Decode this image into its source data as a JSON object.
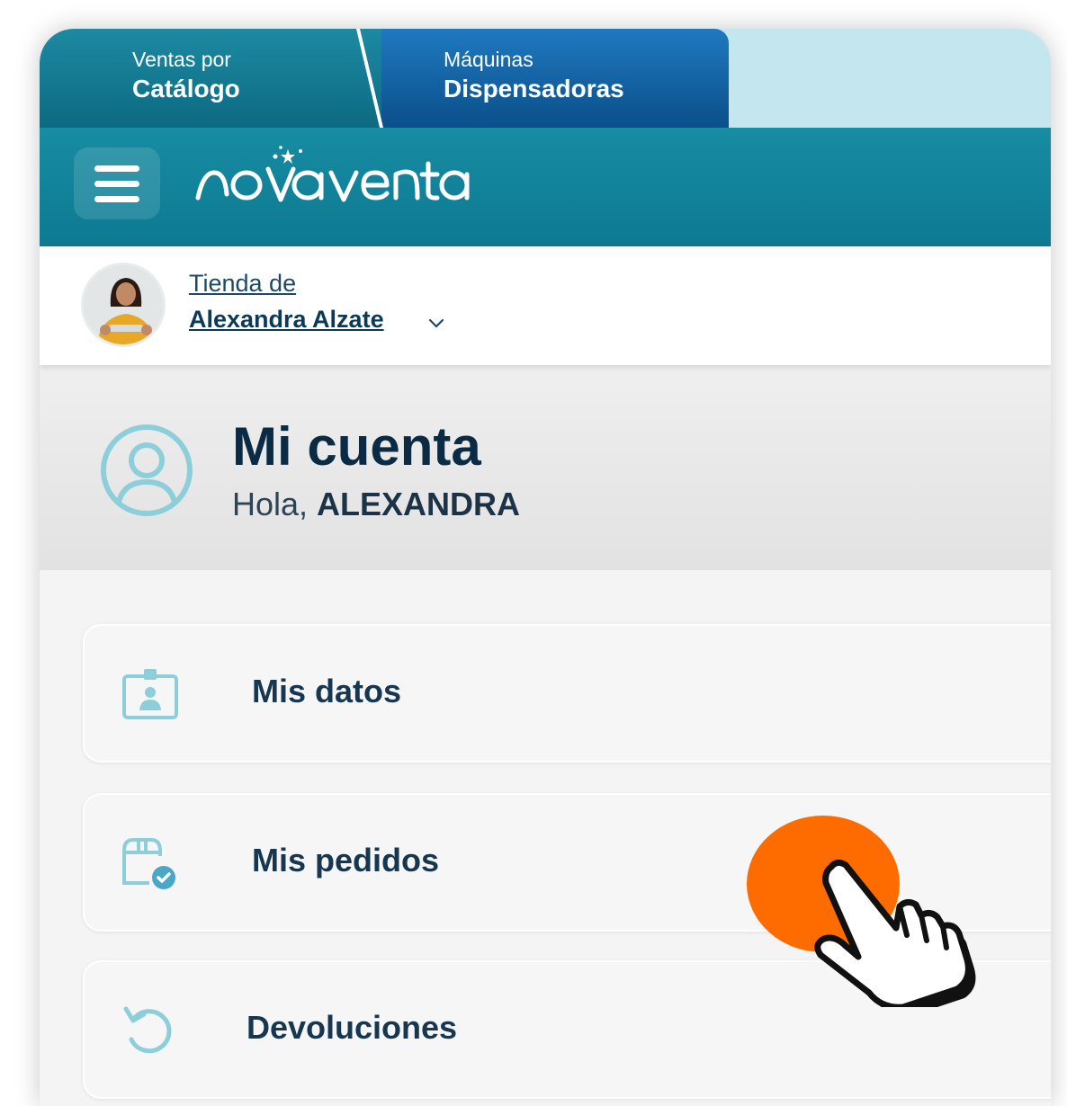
{
  "tabs": {
    "catalogo": {
      "small": "Ventas por",
      "big": "Catálogo"
    },
    "maquinas": {
      "small": "Máquinas",
      "big": "Dispensadoras"
    }
  },
  "brand": {
    "logo_text": "novaventa"
  },
  "store": {
    "label": "Tienda de",
    "name": "Alexandra Alzate"
  },
  "account": {
    "title": "Mi cuenta",
    "greeting_prefix": "Hola, ",
    "user_name": "ALEXANDRA"
  },
  "menu_items": [
    {
      "label": "Mis datos",
      "icon": "id-card-icon"
    },
    {
      "label": "Mis pedidos",
      "icon": "package-check-icon"
    },
    {
      "label": "Devoluciones",
      "icon": "undo-arrow-icon"
    }
  ],
  "colors": {
    "brand_teal": "#0d7a92",
    "tab_blue": "#0a4f8a",
    "icon_teal": "#8bcdd8",
    "text_dark": "#0b2b45",
    "tap_orange": "#fe6c00"
  }
}
